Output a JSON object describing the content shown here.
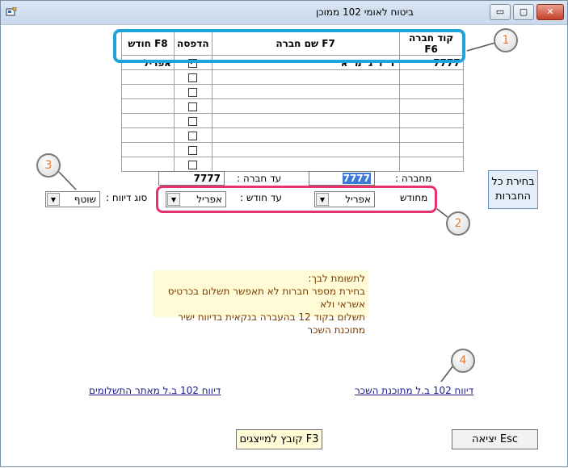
{
  "window": {
    "title": "ביטוח לאומי 102 ממוכן",
    "controls": {
      "minimize": "▭",
      "maximize": "▢",
      "close": "✕"
    }
  },
  "grid": {
    "headers": {
      "code": "קוד חברה F6",
      "name": "שם חברה F7",
      "print": "הדפסה",
      "month": "חודש F8"
    },
    "rows": [
      {
        "code": "7777",
        "name": "ד ו ג מ א",
        "print": true,
        "month": "אפריל"
      },
      {
        "code": "",
        "name": "",
        "print": false,
        "month": ""
      },
      {
        "code": "",
        "name": "",
        "print": false,
        "month": ""
      },
      {
        "code": "",
        "name": "",
        "print": false,
        "month": ""
      },
      {
        "code": "",
        "name": "",
        "print": false,
        "month": ""
      },
      {
        "code": "",
        "name": "",
        "print": false,
        "month": ""
      },
      {
        "code": "",
        "name": "",
        "print": false,
        "month": ""
      },
      {
        "code": "",
        "name": "",
        "print": false,
        "month": ""
      }
    ]
  },
  "filters": {
    "from_company_label": "מחברה :",
    "from_company_value": "7777",
    "to_company_label": "עד חברה :",
    "to_company_value": "7777",
    "from_month_label": "מחודש",
    "from_month_value": "אפריל",
    "to_month_label": "עד חודש :",
    "to_month_value": "אפריל",
    "report_type_label": "סוג דיווח :",
    "report_type_value": "שוטף"
  },
  "select_all_button": {
    "line1": "בחירת כל",
    "line2": "החברות"
  },
  "note": {
    "title": "לתשומת לבך:",
    "line1": "בחירת מספר חברות לא תאפשר תשלום בכרטיס אשראי ולא",
    "line2": "תשלום בקוד 12 בהעברה בנקאית בדיווח ישיר מתוכנת השכר"
  },
  "links": {
    "from_payroll": "דיווח 102 ב.ל מתוכנת השכר",
    "from_payments_site": "דיווח 102 ב.ל מאתר התשלומים"
  },
  "buttons": {
    "file_for_reps": "קובץ למייצגים F3",
    "exit": "יציאה Esc"
  },
  "callouts": [
    "1",
    "2",
    "3",
    "4"
  ],
  "colors": {
    "callout_blue": "#1fa3dc",
    "callout_pink": "#e8336a",
    "callout_number": "#e27a3a"
  }
}
